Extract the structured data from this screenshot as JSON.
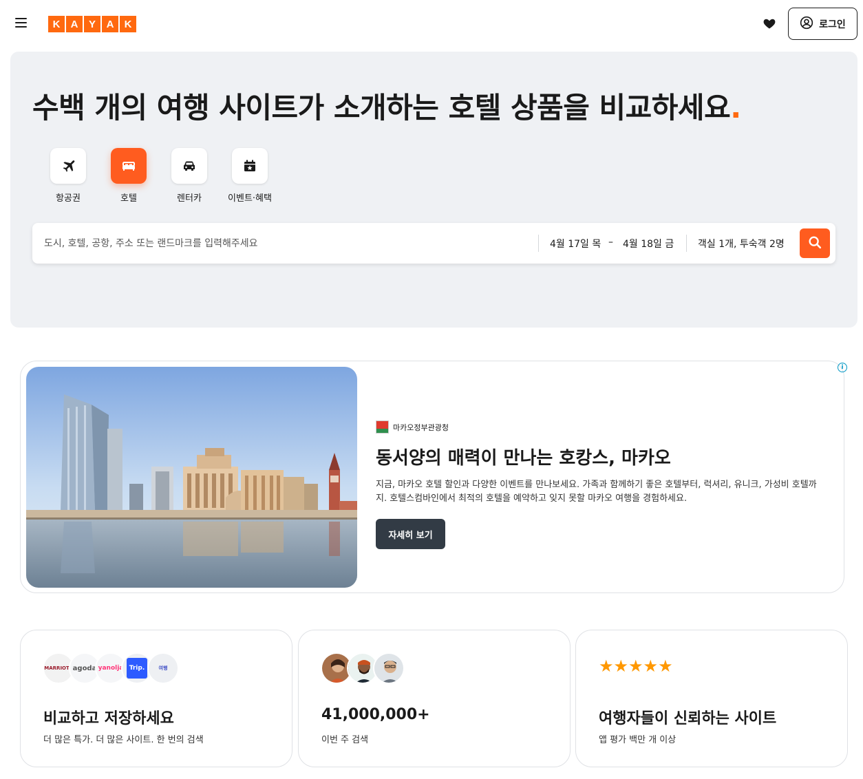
{
  "header": {
    "logo_letters": [
      "K",
      "A",
      "Y",
      "A",
      "K"
    ],
    "login_label": "로그인"
  },
  "hero": {
    "title": "수백 개의 여행 사이트가 소개하는 호텔 상품을 비교하세요",
    "title_dot": ".",
    "categories": [
      {
        "label": "항공권",
        "icon": "plane-icon",
        "active": false
      },
      {
        "label": "호텔",
        "icon": "bed-icon",
        "active": true
      },
      {
        "label": "렌터카",
        "icon": "car-icon",
        "active": false
      },
      {
        "label": "이벤트·혜택",
        "icon": "calendar-star-icon",
        "active": false
      }
    ]
  },
  "search": {
    "placeholder": "도시, 호텔, 공항, 주소 또는 랜드마크를 입력해주세요",
    "check_in": "4월 17일 목",
    "separator": "–",
    "check_out": "4월 18일 금",
    "guests": "객실 1개, 투숙객 2명"
  },
  "ad": {
    "info": "i",
    "brand": "마카오정부관광청",
    "title": "동서양의 매력이 만나는 호캉스, 마카오",
    "description": "지금, 마카오 호텔 할인과 다양한 이벤트를 만나보세요. 가족과 함께하기 좋은 호텔부터, 럭셔리, 유니크, 가성비 호텔까지. 호텔스컴바인에서 최적의 호텔을 예약하고 잊지 못할 마카오 여행을 경험하세요.",
    "button": "자세히 보기"
  },
  "features": [
    {
      "title": "비교하고 저장하세요",
      "subtitle": "더 많은 특가. 더 많은 사이트. 한 번의 검색",
      "logos": [
        "MARRIOTT",
        "agoda",
        "yanolja",
        "Trip.",
        "여행"
      ]
    },
    {
      "title": "41,000,000+",
      "subtitle": "이번 주 검색"
    },
    {
      "title": "여행자들이 신뢰하는 사이트",
      "subtitle": "앱 평가 백만 개 이상",
      "rating_stars": 5,
      "stars_text": "★★★★★"
    }
  ],
  "colors": {
    "brand_orange": "#ff690f",
    "hero_bg": "#eff1f4",
    "button_dark": "#323b45",
    "star": "#ff9800"
  }
}
